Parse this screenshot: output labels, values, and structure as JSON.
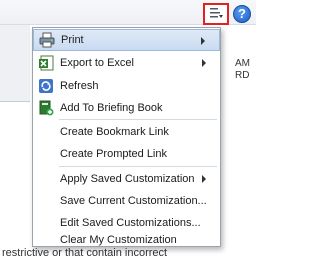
{
  "background": {
    "right_text_line1": "AM",
    "right_text_line2": "RD",
    "bottom_text": "restrictive or that contain incorrect"
  },
  "toolbar": {
    "tools_icon": "page-options-icon",
    "help_label": "?",
    "help_icon": "help-icon"
  },
  "menu": {
    "items": [
      {
        "label": "Print",
        "icon": "print-icon",
        "submenu": true,
        "highlighted": true
      },
      {
        "label": "Export to Excel",
        "icon": "excel-icon",
        "submenu": true
      },
      {
        "label": "Refresh",
        "icon": "refresh-icon",
        "submenu": false
      },
      {
        "label": "Add To Briefing Book",
        "icon": "briefing-book-icon",
        "submenu": false
      },
      {
        "label": "Create Bookmark Link",
        "icon": "",
        "submenu": false
      },
      {
        "label": "Create Prompted Link",
        "icon": "",
        "submenu": false
      },
      {
        "label": "Apply Saved Customization",
        "icon": "",
        "submenu": true
      },
      {
        "label": "Save Current Customization...",
        "icon": "",
        "submenu": false
      },
      {
        "label": "Edit Saved Customizations...",
        "icon": "",
        "submenu": false
      },
      {
        "label": "Clear My Customization",
        "icon": "",
        "submenu": false
      }
    ]
  },
  "colors": {
    "highlight_border": "#e52020",
    "menu_hover": "#c9dbf2"
  }
}
